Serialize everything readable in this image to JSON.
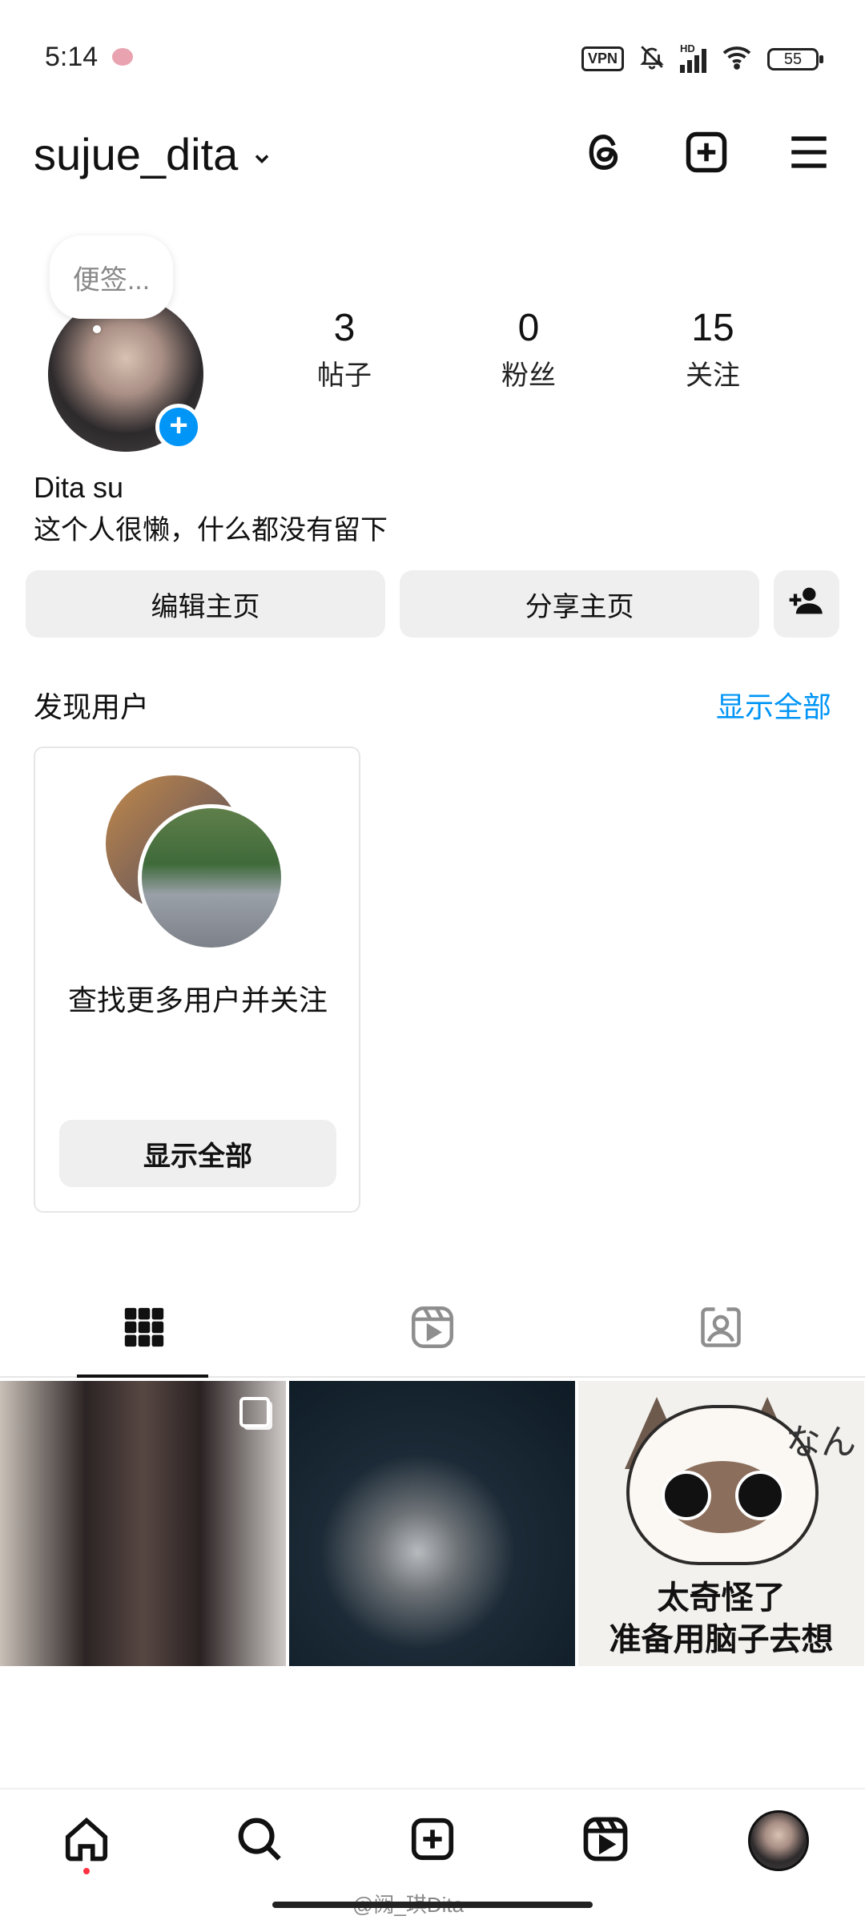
{
  "status_bar": {
    "time": "5:14",
    "vpn": "VPN",
    "network": "HD",
    "battery": "55"
  },
  "header": {
    "username": "sujue_dita"
  },
  "profile": {
    "note": "便签...",
    "display_name": "Dita su",
    "bio": "这个人很懒，什么都没有留下",
    "stats": [
      {
        "value": "3",
        "label": "帖子"
      },
      {
        "value": "0",
        "label": "粉丝"
      },
      {
        "value": "15",
        "label": "关注"
      }
    ],
    "edit_button": "编辑主页",
    "share_button": "分享主页"
  },
  "discover": {
    "title": "发现用户",
    "show_all": "显示全部",
    "card_text": "查找更多用户并关注",
    "card_button": "显示全部"
  },
  "posts": {
    "cat_lines": [
      "太奇怪了",
      "准备用脑子去想"
    ],
    "cat_side": "なん"
  },
  "watermark": "@阙_琪Dita",
  "colors": {
    "accent": "#0095f6",
    "button_bg": "#efefef",
    "notification_dot": "#ff3040"
  }
}
